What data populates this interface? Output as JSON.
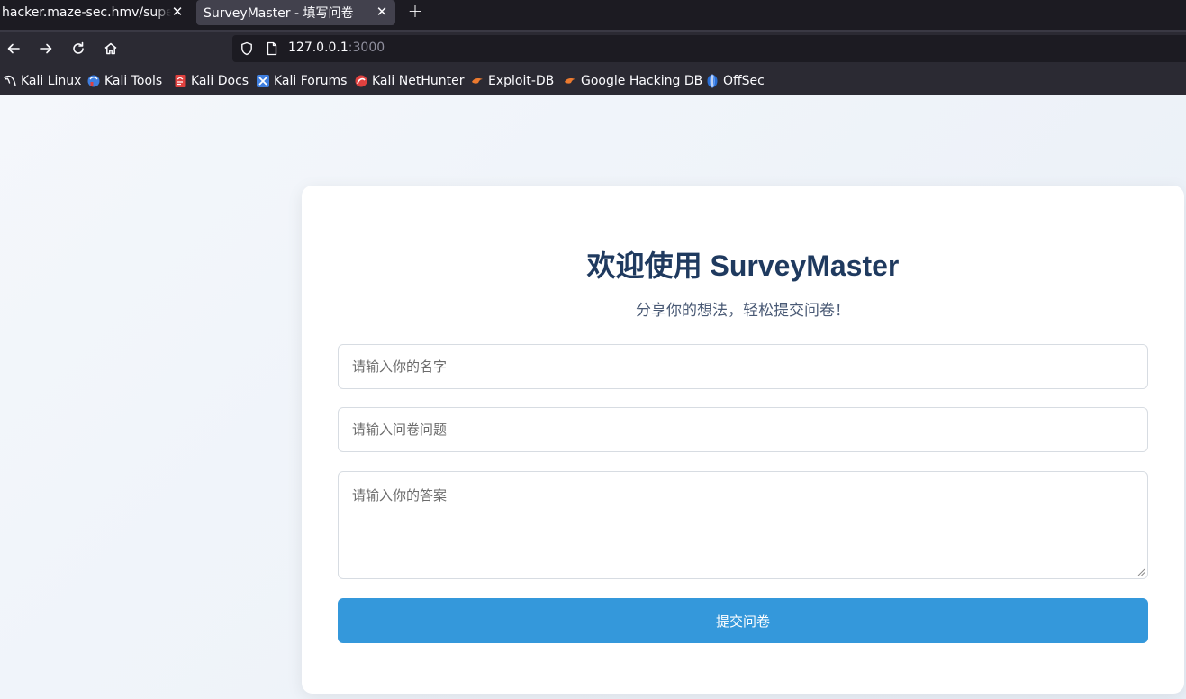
{
  "browser": {
    "tabs": [
      {
        "title": "hacker.maze-sec.hmv/superc",
        "active": false
      },
      {
        "title": "SurveyMaster - 填写问卷",
        "active": true
      }
    ],
    "url_host": "127.0.0.1",
    "url_port": ":3000",
    "bookmarks": [
      {
        "label": "Kali Linux",
        "icon": "kali-dragon-icon"
      },
      {
        "label": "Kali Tools",
        "icon": "kali-tools-icon"
      },
      {
        "label": "Kali Docs",
        "icon": "kali-docs-icon"
      },
      {
        "label": "Kali Forums",
        "icon": "kali-forums-icon"
      },
      {
        "label": "Kali NetHunter",
        "icon": "nethunter-icon"
      },
      {
        "label": "Exploit-DB",
        "icon": "exploit-db-icon"
      },
      {
        "label": "Google Hacking DB",
        "icon": "ghdb-icon"
      },
      {
        "label": "OffSec",
        "icon": "offsec-icon"
      }
    ]
  },
  "survey": {
    "title": "欢迎使用 SurveyMaster",
    "subtitle": "分享你的想法，轻松提交问卷！",
    "name_placeholder": "请输入你的名字",
    "question_placeholder": "请输入问卷问题",
    "answer_placeholder": "请输入你的答案",
    "submit_label": "提交问卷"
  },
  "colors": {
    "accent": "#3498db",
    "title": "#1f3a5f",
    "browser_chrome": "#2b2a33"
  }
}
